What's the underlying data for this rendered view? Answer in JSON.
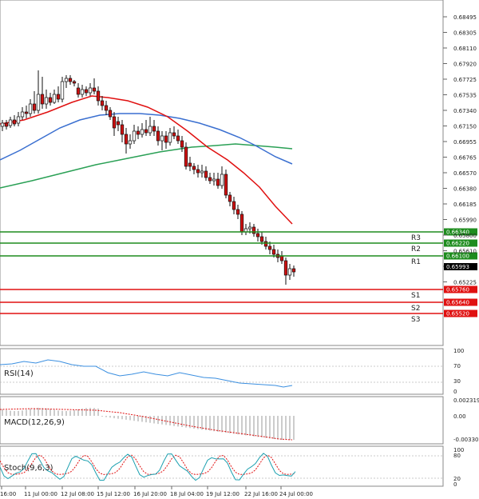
{
  "price_axis": {
    "ticks": [
      "0.68495",
      "0.68305",
      "0.68110",
      "0.67920",
      "0.67725",
      "0.67535",
      "0.67340",
      "0.67150",
      "0.66955",
      "0.66765",
      "0.66570",
      "0.66380",
      "0.66185",
      "0.65990",
      "0.65800",
      "0.65610",
      "0.65415",
      "0.65225"
    ],
    "current_price": "0.65993"
  },
  "levels": [
    {
      "name": "R3",
      "value": "0.66340",
      "role": "resistance",
      "color": "#1e8c1e"
    },
    {
      "name": "R2",
      "value": "0.66220",
      "role": "resistance",
      "color": "#1e8c1e"
    },
    {
      "name": "R1",
      "value": "0.66100",
      "role": "resistance",
      "color": "#1e8c1e"
    },
    {
      "name": "S1",
      "value": "0.65760",
      "role": "support",
      "color": "#e01010"
    },
    {
      "name": "S2",
      "value": "0.65640",
      "role": "support",
      "color": "#e01010"
    },
    {
      "name": "S3",
      "value": "0.65520",
      "role": "support",
      "color": "#e01010"
    }
  ],
  "indicators": {
    "rsi": {
      "label": "RSI(14)",
      "ticks": [
        "100",
        "70",
        "30",
        "0"
      ]
    },
    "macd": {
      "label": "MACD(12,26,9)",
      "ticks": [
        "0.002319",
        "0.00",
        "-0.003305"
      ]
    },
    "stoch": {
      "label": "Stoch(9,6,3)",
      "ticks": [
        "100",
        "80",
        "20",
        "0"
      ]
    }
  },
  "time_axis": {
    "labels": [
      "16:00",
      "11 Jul 00:00",
      "12 Jul 08:00",
      "15 Jul 12:00",
      "16 Jul 20:00",
      "18 Jul 04:00",
      "19 Jul 12:00",
      "22 Jul 16:00",
      "24 Jul 00:00"
    ]
  },
  "colors": {
    "up_candle": "#ffffff",
    "down_candle": "#d01010",
    "ma_fast": "#e01010",
    "ma_mid": "#3a6fd0",
    "ma_slow": "#2aa055",
    "rsi_line": "#3b8fe0",
    "macd_signal": "#e01010",
    "stoch_main": "#1ba0b0",
    "stoch_signal": "#e01010"
  }
}
